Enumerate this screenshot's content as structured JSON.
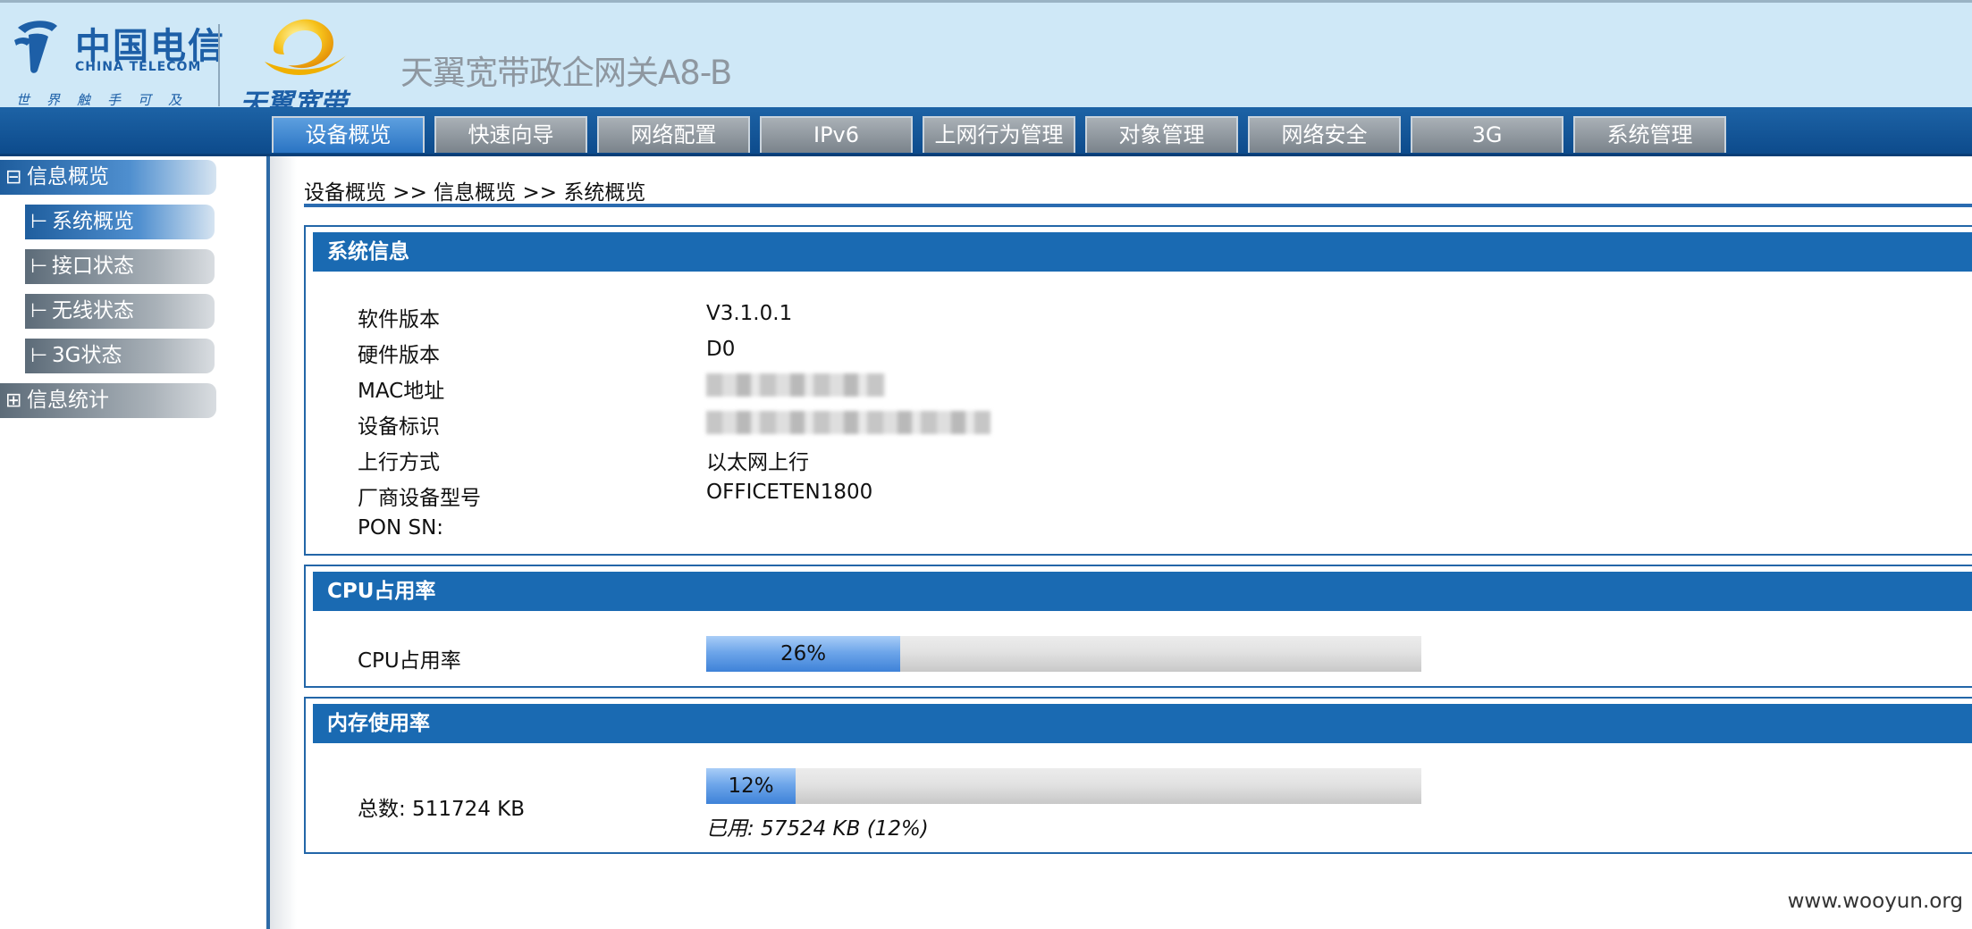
{
  "header": {
    "brand_cn": "中国电信",
    "brand_en": "CHINA TELECOM",
    "brand_slogan": "世界触手可及",
    "sub_brand": "天翼宽带",
    "device_title": "天翼宽带政企网关A8-B"
  },
  "nav": {
    "tabs": [
      {
        "label": "设备概览",
        "active": true
      },
      {
        "label": "快速向导",
        "active": false
      },
      {
        "label": "网络配置",
        "active": false
      },
      {
        "label": "IPv6",
        "active": false
      },
      {
        "label": "上网行为管理",
        "active": false
      },
      {
        "label": "对象管理",
        "active": false
      },
      {
        "label": "网络安全",
        "active": false
      },
      {
        "label": "3G",
        "active": false
      },
      {
        "label": "系统管理",
        "active": false
      }
    ]
  },
  "sidebar": {
    "groups": [
      {
        "label": "信息概览",
        "glyph": "⊟",
        "expanded": true,
        "items": [
          {
            "label": "系统概览",
            "glyph": "⊢",
            "active": true
          },
          {
            "label": "接口状态",
            "glyph": "⊢",
            "active": false
          },
          {
            "label": "无线状态",
            "glyph": "⊢",
            "active": false
          },
          {
            "label": "3G状态",
            "glyph": "⊢",
            "active": false
          }
        ]
      },
      {
        "label": "信息统计",
        "glyph": "⊞",
        "expanded": false,
        "items": []
      }
    ]
  },
  "breadcrumb": "设备概览 >> 信息概览 >> 系统概览",
  "system_info": {
    "title": "系统信息",
    "rows": [
      {
        "label": "软件版本",
        "value": "V3.1.0.1"
      },
      {
        "label": "硬件版本",
        "value": "D0"
      },
      {
        "label": "MAC地址",
        "value": ""
      },
      {
        "label": "设备标识",
        "value": ""
      },
      {
        "label": "上行方式",
        "value": "以太网上行"
      },
      {
        "label": "厂商设备型号",
        "value": "OFFICETEN1800"
      },
      {
        "label": "PON SN:",
        "value": ""
      }
    ]
  },
  "cpu": {
    "title": "CPU占用率",
    "label": "CPU占用率",
    "percent": 26,
    "percent_text": "26%"
  },
  "memory": {
    "title": "内存使用率",
    "total_text": "总数: 511724 KB",
    "percent": 12,
    "percent_text": "12%",
    "used_text": "已用: 57524 KB (12%)"
  },
  "watermark": "www.wooyun.org",
  "colors": {
    "header_bg": "#cfe8f7",
    "nav_bg": "#0d4b8c",
    "panel_head": "#1a6ab2",
    "bar_fill": "#3e82d8"
  }
}
